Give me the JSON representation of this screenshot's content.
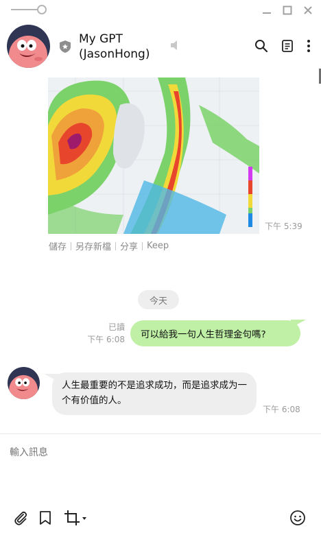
{
  "window": {
    "minimize_icon": "minimize-icon",
    "maximize_icon": "maximize-icon",
    "close_icon": "close-icon"
  },
  "header": {
    "title": "My GPT (JasonHong)",
    "icons": [
      "shield-icon",
      "speaker-icon",
      "search-icon",
      "notes-icon",
      "more-icon"
    ]
  },
  "messages": {
    "image_time": "下午 5:39",
    "image_actions": [
      "儲存",
      "另存新檔",
      "分享",
      "Keep"
    ],
    "date_separator": "今天",
    "outgoing": {
      "read_label": "已讀",
      "time": "下午 6:08",
      "text": "可以給我一句人生哲理金句嗎?"
    },
    "incoming": {
      "text": "人生最重要的不是追求成功，而是追求成为一个有价值的人。",
      "time": "下午 6:08"
    }
  },
  "composer": {
    "placeholder": "輸入訊息"
  },
  "toolbar": {
    "icons": [
      "attach-icon",
      "bookmark-icon",
      "crop-icon",
      "emoji-icon"
    ]
  },
  "colors": {
    "outgoing_bubble": "#bff0a5",
    "incoming_bubble": "#eeeeee",
    "accent": "#111111"
  }
}
